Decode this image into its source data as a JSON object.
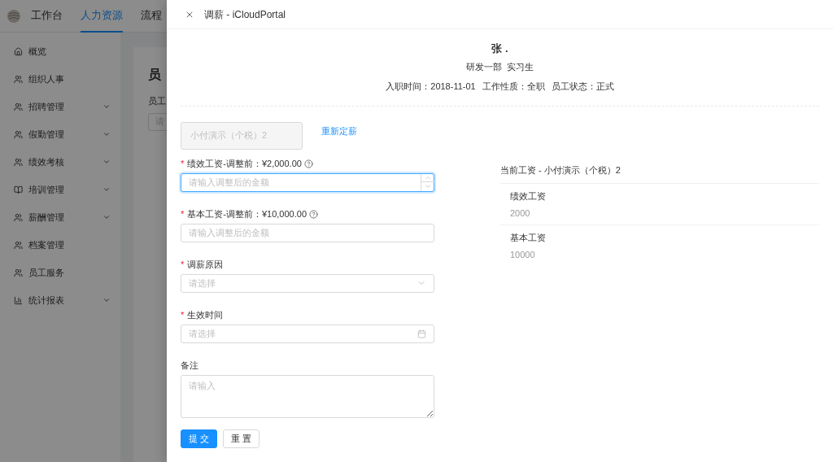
{
  "background": {
    "nav_tabs": [
      {
        "label": "工作台",
        "selected": false
      },
      {
        "label": "人力资源",
        "selected": true
      },
      {
        "label": "流程",
        "selected": false
      }
    ],
    "sidebar": {
      "items": [
        {
          "label": "概览",
          "has_submenu": false
        },
        {
          "label": "组织人事",
          "has_submenu": false
        },
        {
          "label": "招聘管理",
          "has_submenu": true
        },
        {
          "label": "假勤管理",
          "has_submenu": true
        },
        {
          "label": "绩效考核",
          "has_submenu": true
        },
        {
          "label": "培训管理",
          "has_submenu": true
        },
        {
          "label": "薪酬管理",
          "has_submenu": true
        },
        {
          "label": "档案管理",
          "has_submenu": false
        },
        {
          "label": "员工服务",
          "has_submenu": false
        },
        {
          "label": "统计报表",
          "has_submenu": true
        }
      ]
    },
    "page_title": "员",
    "filter_label": "员工",
    "filter_placeholder": "请"
  },
  "drawer": {
    "title": "调薪 - iCloudPortal",
    "employee": {
      "name": "张 .",
      "department": "研发一部",
      "position": "实习生",
      "info": [
        "入职时间：2018-11-01",
        "工作性质：全职",
        "员工状态：正式"
      ]
    },
    "scheme": {
      "value": "小付演示（个税）2",
      "disabled": true,
      "link": "重新定薪"
    },
    "fields": [
      {
        "kind": "number",
        "label": "绩效工资-调整前：¥2,000.00",
        "required_mark": "*",
        "help": true,
        "placeholder": "请输入调整后的金额",
        "focused": true
      },
      {
        "kind": "text",
        "label": "基本工资-调整前：¥10,000.00",
        "required_mark": "*",
        "help": true,
        "placeholder": "请输入调整后的金额",
        "focused": false
      },
      {
        "kind": "select",
        "label": "调薪原因",
        "required_mark": "*",
        "help": false,
        "placeholder": "请选择",
        "focused": false
      },
      {
        "kind": "date",
        "label": "生效时间",
        "required_mark": "*",
        "help": false,
        "placeholder": "请选择",
        "focused": false
      },
      {
        "kind": "textarea",
        "label": "备注",
        "help": false,
        "placeholder": "请输入",
        "focused": false
      }
    ],
    "buttons": [
      {
        "label": "提 交",
        "primary": true
      },
      {
        "label": "重 置",
        "primary": false
      }
    ],
    "current_salary": {
      "title": "当前工资 - 小付演示（个税）2",
      "items": [
        {
          "name": "绩效工资",
          "value": "2000"
        },
        {
          "name": "基本工资",
          "value": "10000"
        }
      ]
    }
  }
}
